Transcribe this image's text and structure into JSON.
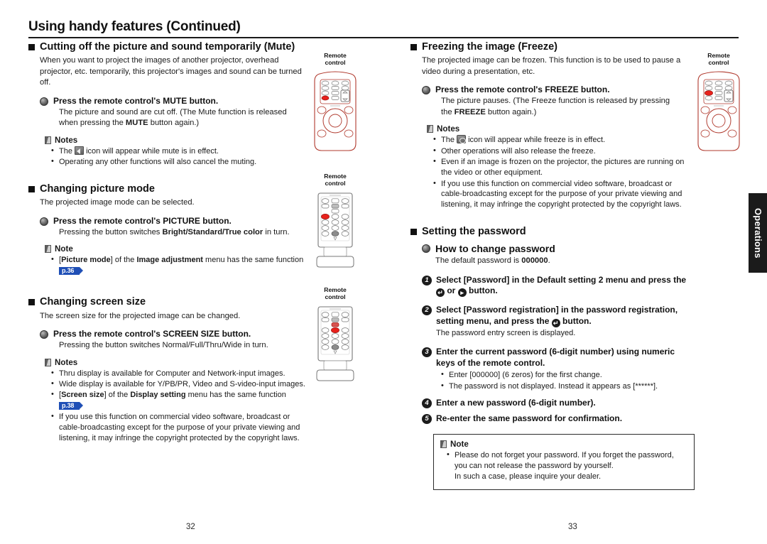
{
  "header": {
    "title": "Using handy features (Continued)"
  },
  "side_tab": {
    "label": "Operations"
  },
  "folios": {
    "left": "32",
    "right": "33"
  },
  "left_column": {
    "mute": {
      "heading": "Cutting off the picture and sound temporarily (Mute)",
      "intro": "When you want to project the images of another projector, overhead projector, etc. temporarily, this projector's images and sound can be turned off.",
      "step_head": "Press the remote control's MUTE button.",
      "step_sub_a": "The picture and sound are cut off. (The Mute function is released",
      "step_sub_b_pre": "when pressing the ",
      "step_sub_b_bold": "MUTE",
      "step_sub_b_post": " button again.)",
      "notes_label": "Notes",
      "note1_pre": "The ",
      "note1_post": " icon will appear while mute is in effect.",
      "note2": "Operating any other functions will also cancel the muting."
    },
    "picture_mode": {
      "heading": "Changing picture mode",
      "intro": "The projected image mode can be selected.",
      "step_head": "Press the remote control's PICTURE button.",
      "step_sub_pre": "Pressing the button switches ",
      "step_sub_bold": "Bright/Standard/True color",
      "step_sub_post": " in turn.",
      "note_label": "Note",
      "note1_a": "[",
      "note1_b": "Picture mode",
      "note1_c": "] of the ",
      "note1_d": "Image adjustment",
      "note1_e": " menu has the same function ",
      "note1_ref": "p.36",
      "note1_f": "."
    },
    "screen_size": {
      "heading": "Changing screen size",
      "intro": "The screen size for the projected image can be changed.",
      "step_head": "Press the remote control's SCREEN SIZE button.",
      "step_sub": "Pressing the button switches Normal/Full/Thru/Wide in turn.",
      "notes_label": "Notes",
      "note1": "Thru display is available for Computer and Network-input images.",
      "note2": "Wide display is available for Y/PB/PR, Video and S-video-input images.",
      "note3_a": "[",
      "note3_b": "Screen size",
      "note3_c": "] of the ",
      "note3_d": "Display setting",
      "note3_e": " menu has the same function ",
      "note3_ref": "p.38",
      "note3_f": ".",
      "note4": "If you use this function on commercial video software, broadcast or cable-broadcasting except for the purpose of your private viewing and listening, it may infringe the copyright protected by the copyright laws."
    }
  },
  "right_column": {
    "freeze": {
      "heading": "Freezing the image (Freeze)",
      "intro": "The projected image can be frozen. This function is to be used to pause a video during a presentation, etc.",
      "step_head": "Press the remote control's FREEZE button.",
      "step_sub_a": "The picture pauses. (The Freeze function is released by pressing",
      "step_sub_b_pre": "the ",
      "step_sub_b_bold": "FREEZE",
      "step_sub_b_post": " button again.)",
      "notes_label": "Notes",
      "note1_pre": "The ",
      "note1_post": " icon will appear while freeze is in effect.",
      "note2": "Other operations will also release the freeze.",
      "note3": "Even if an image is frozen on the projector, the pictures are running on the video or other equipment.",
      "note4": "If you use this function on commercial video software, broadcast or cable-broadcasting except for the purpose of your private viewing and listening, it may infringe the copyright protected by the copyright laws."
    },
    "password": {
      "heading": "Setting the password",
      "sub_heading": "How to change password",
      "sub_intro_pre": "The default password is ",
      "sub_intro_bold": "000000",
      "sub_intro_post": ".",
      "steps": [
        {
          "num": "1",
          "head_a": "Select [Password] in the Default setting 2 menu and press the ",
          "head_b": " or ",
          "head_c": " button.",
          "sub": ""
        },
        {
          "num": "2",
          "head_a": "Select [Password registration] in the password registration, setting menu, and press the ",
          "head_b": " button.",
          "sub": "The password entry screen is displayed."
        },
        {
          "num": "3",
          "head_a": "Enter the current password (6-digit number) using numeric keys of the remote control.",
          "sub": ""
        },
        {
          "num": "4",
          "head_a": "Enter a new password (6-digit number).",
          "sub": ""
        },
        {
          "num": "5",
          "head_a": "Re-enter the same password for confirmation.",
          "sub": ""
        }
      ],
      "step3_bullets": [
        "Enter [000000] (6 zeros) for the first change.",
        "The password is not displayed. Instead it appears as [******]."
      ],
      "note_label": "Note",
      "note_line1": "Please do not forget your password. If you forget the password, you can not release the password by yourself.",
      "note_line2": "In such a case, please inquire your dealer."
    }
  },
  "figures": {
    "caption": "Remote\ncontrol",
    "items": [
      {
        "id": "remote-mute",
        "type": "round",
        "highlight": "mute"
      },
      {
        "id": "remote-picture",
        "type": "keypad",
        "highlight": "picture"
      },
      {
        "id": "remote-screensize",
        "type": "keypad",
        "highlight": "screensize"
      },
      {
        "id": "remote-freeze",
        "type": "round",
        "highlight": "freeze"
      }
    ]
  },
  "colors": {
    "accent_blue": "#1f4fb6",
    "highlight_red": "#e8211c",
    "tab_black": "#1b1b1b"
  }
}
